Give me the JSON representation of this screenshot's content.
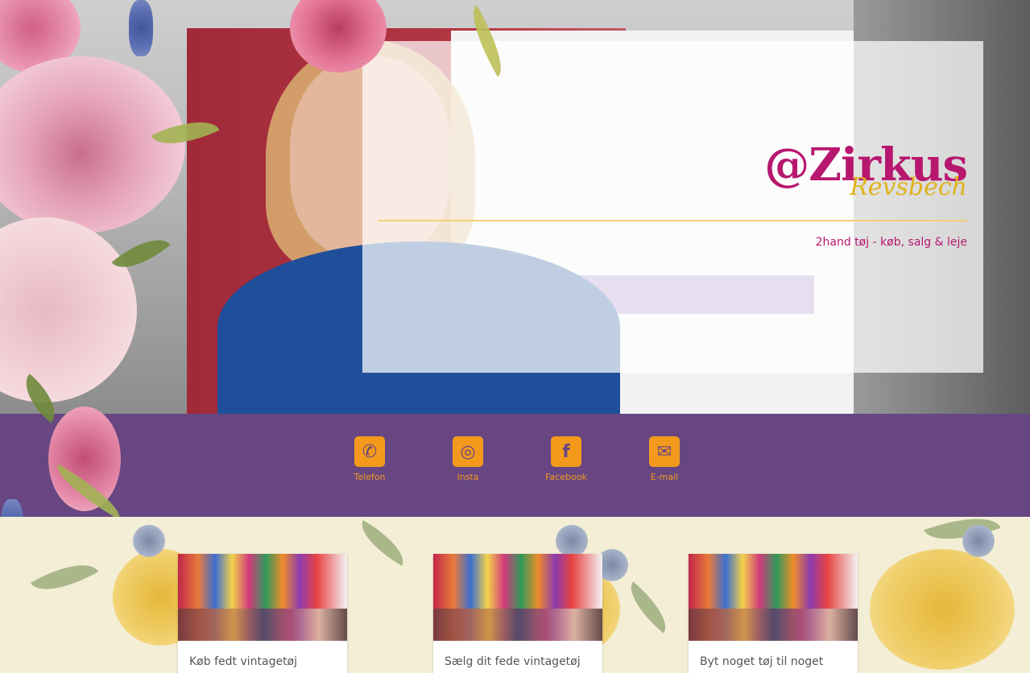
{
  "hero": {
    "logo_main": "@Zirkus",
    "logo_sub": "Revsbech",
    "tagline": "2hand tøj - køb, salg & leje"
  },
  "social": {
    "items": [
      {
        "label": "Telefon",
        "icon": "phone-icon"
      },
      {
        "label": "Insta",
        "icon": "instagram-icon"
      },
      {
        "label": "Facebook",
        "icon": "facebook-icon"
      },
      {
        "label": "E-mail",
        "icon": "envelope-icon"
      }
    ]
  },
  "cards": [
    {
      "title": "Køb fedt vintagetøj"
    },
    {
      "title": "Sælg dit fede vintagetøj"
    },
    {
      "title": "Byt noget tøj til noget"
    }
  ],
  "colors": {
    "purple": "#674682",
    "orange": "#f39a1c",
    "magenta": "#b7176e",
    "gold": "#e0b21c"
  }
}
